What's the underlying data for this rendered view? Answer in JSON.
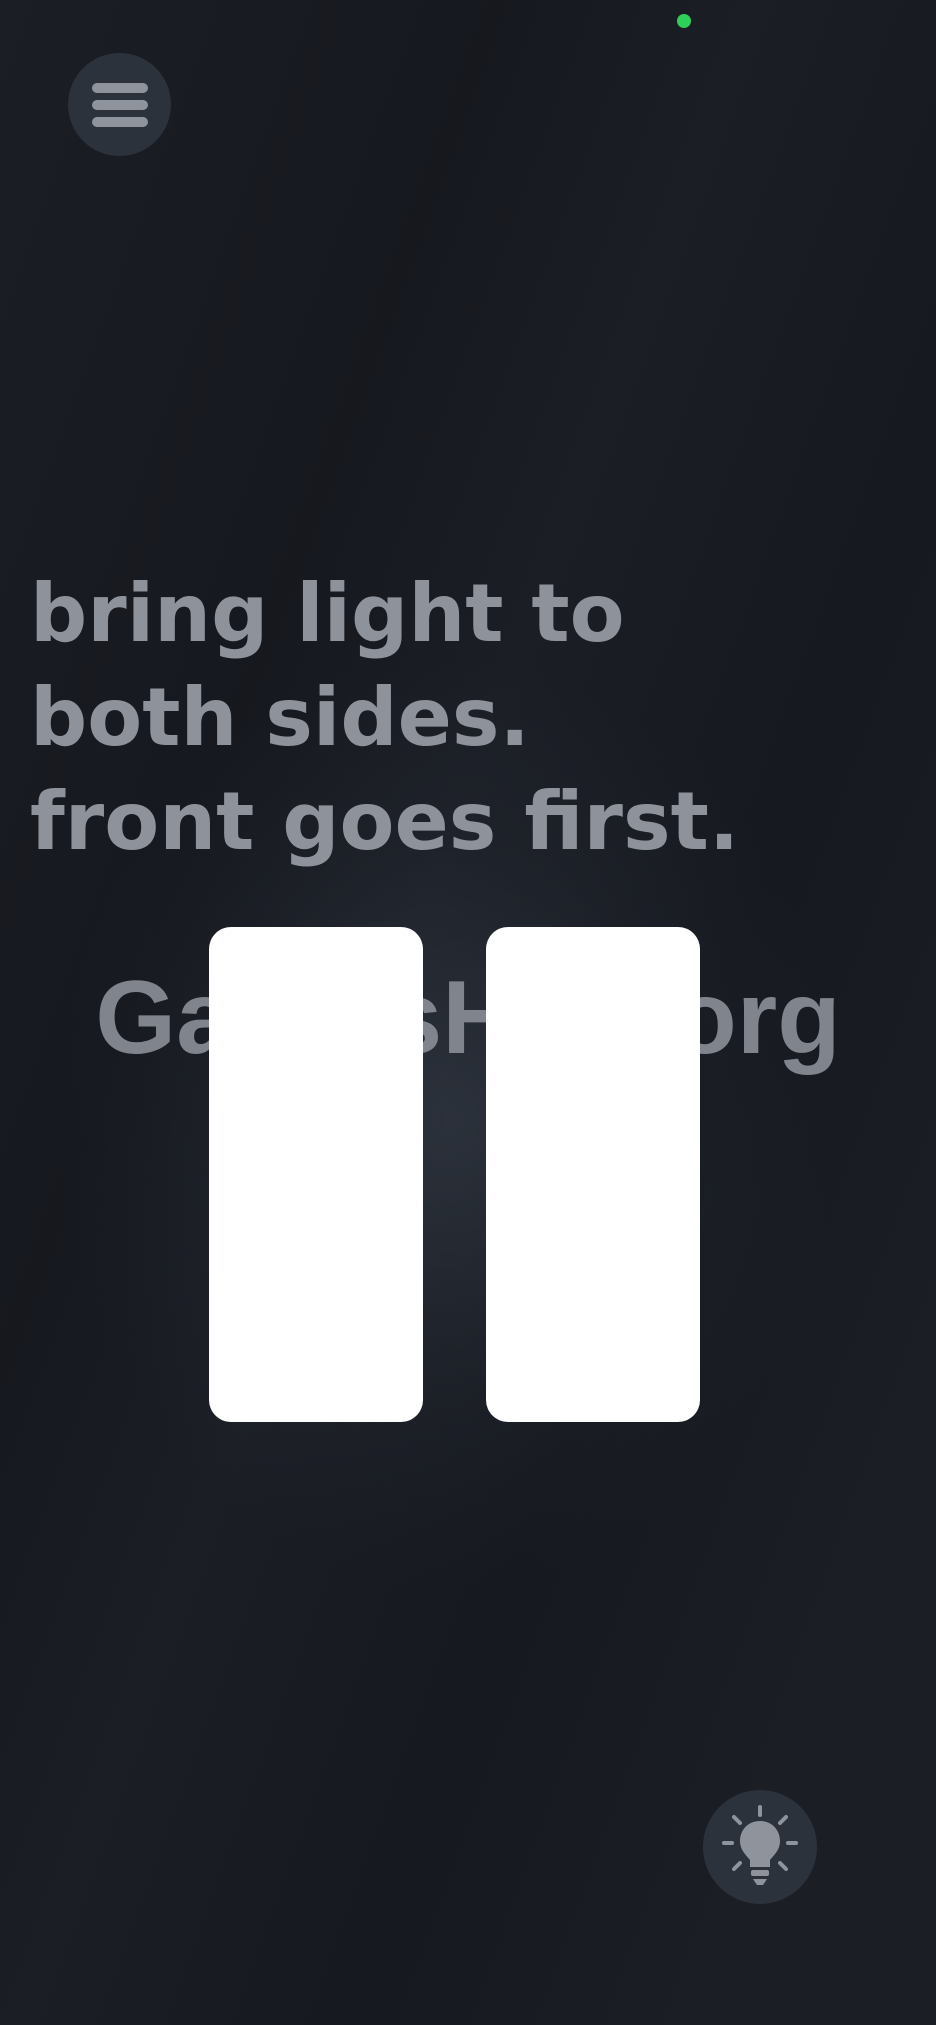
{
  "status": {
    "indicator_color": "#2fcf5a"
  },
  "menu": {
    "icon": "hamburger-menu-icon"
  },
  "hint": {
    "lines": [
      "bring light to",
      "both sides.",
      "front goes first."
    ]
  },
  "watermark": {
    "text": "GamesHub.org"
  },
  "cards": [
    {
      "side": "front",
      "color": "#ffffff"
    },
    {
      "side": "back",
      "color": "#ffffff"
    }
  ],
  "hint_button": {
    "icon": "lightbulb-icon"
  },
  "colors": {
    "background": "#1b1e25",
    "button_bg": "#2c323b",
    "text_muted": "#8e929b"
  }
}
